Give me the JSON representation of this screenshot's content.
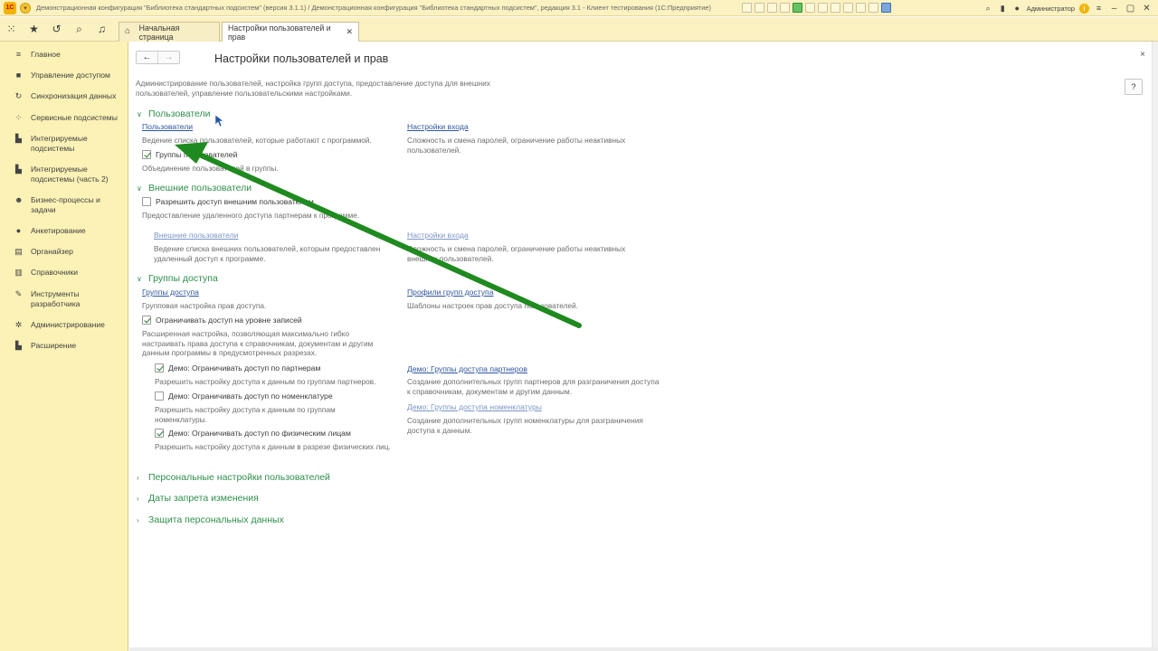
{
  "window": {
    "title": "Демонстрационная конфигурация \"Библиотека стандартных подсистем\" (версия 3.1.1) / Демонстрационная конфигурация \"Библиотека стандартных подсистем\", редакция 3.1 - Клиент тестирования (1С:Предприятие)",
    "logo": "1С",
    "user": "Администратор"
  },
  "tabs": [
    {
      "label": "Начальная страница"
    },
    {
      "label": "Настройки пользователей и прав"
    }
  ],
  "sidebar": {
    "items": [
      {
        "label": "Главное",
        "icon": "list-icon"
      },
      {
        "label": "Управление доступом",
        "icon": "lock-icon"
      },
      {
        "label": "Синхронизация данных",
        "icon": "sync-icon"
      },
      {
        "label": "Сервисные подсистемы",
        "icon": "tools-icon"
      },
      {
        "label": "Интегрируемые подсистемы",
        "icon": "chart-icon"
      },
      {
        "label": "Интегрируемые подсистемы (часть 2)",
        "icon": "chart-icon"
      },
      {
        "label": "Бизнес-процессы и задачи",
        "icon": "people-icon"
      },
      {
        "label": "Анкетирование",
        "icon": "help-icon"
      },
      {
        "label": "Органайзер",
        "icon": "calendar-icon"
      },
      {
        "label": "Справочники",
        "icon": "book-icon"
      },
      {
        "label": "Инструменты разработчика",
        "icon": "wrench-icon"
      },
      {
        "label": "Администрирование",
        "icon": "gear-icon"
      },
      {
        "label": "Расширение",
        "icon": "chart-icon"
      }
    ]
  },
  "page": {
    "title": "Настройки пользователей и прав",
    "description": "Администрирование пользователей, настройка групп доступа, предоставление доступа для внешних пользователей, управление пользовательскими настройками.",
    "help_label": "?"
  },
  "users": {
    "section": "Пользователи",
    "users_link": "Пользователи",
    "users_desc": "Ведение списка пользователей, которые работают с программой.",
    "login_link": "Настройки входа",
    "login_desc": "Сложность и смена паролей, ограничение работы неактивных пользователей.",
    "groups_cb": "Группы пользователей",
    "groups_desc": "Объединение пользователей в группы."
  },
  "external": {
    "section": "Внешние пользователи",
    "allow_cb": "Разрешить доступ внешним пользователям",
    "allow_desc": "Предоставление удаленного доступа партнерам к программе.",
    "ext_link": "Внешние пользователи",
    "ext_desc": "Ведение списка внешних пользователей, которым предоставлен удаленный доступ к программе.",
    "login_link": "Настройки входа",
    "login_desc": "Сложность и смена паролей, ограничение работы неактивных внешних пользователей."
  },
  "access": {
    "section": "Группы доступа",
    "groups_link": "Группы доступа",
    "groups_desc": "Групповая настройка прав доступа.",
    "profiles_link": "Профили групп доступа",
    "profiles_desc": "Шаблоны настроек прав доступа пользователей.",
    "rls_cb": "Ограничивать доступ на уровне записей",
    "rls_desc": "Расширенная настройка, позволяющая максимально гибко настраивать права доступа к справочникам, документам и другим данным программы в предусмотренных разрезах.",
    "demo_partners_cb": "Демо: Ограничивать доступ по партнерам",
    "demo_partners_desc": "Разрешить настройку доступа к данным по группам партнеров.",
    "demo_nom_cb": "Демо: Ограничивать доступ по номенклатуре",
    "demo_nom_desc": "Разрешить настройку доступа к данным по группам номенклатуры.",
    "demo_persons_cb": "Демо: Ограничивать доступ по физическим лицам",
    "demo_persons_desc": "Разрешить настройку доступа к данным в разрезе физических лиц.",
    "partner_groups_link": "Демо: Группы доступа партнеров",
    "partner_groups_desc": "Создание дополнительных групп партнеров для разграничения доступа к справочникам, документам и другим данным.",
    "nom_groups_link": "Демо: Группы доступа номенклатуры",
    "nom_groups_desc": "Создание дополнительных групп номенклатуры для разграничения доступа к данным."
  },
  "collapsed": [
    {
      "label": "Персональные настройки пользователей"
    },
    {
      "label": "Даты запрета изменения"
    },
    {
      "label": "Защита персональных данных"
    }
  ],
  "colors": {
    "accent_green": "#2e8f4b",
    "link_blue": "#2f56a0",
    "arrow_green": "#1f8a1f",
    "sidebar_bg": "#fcf2b6"
  }
}
